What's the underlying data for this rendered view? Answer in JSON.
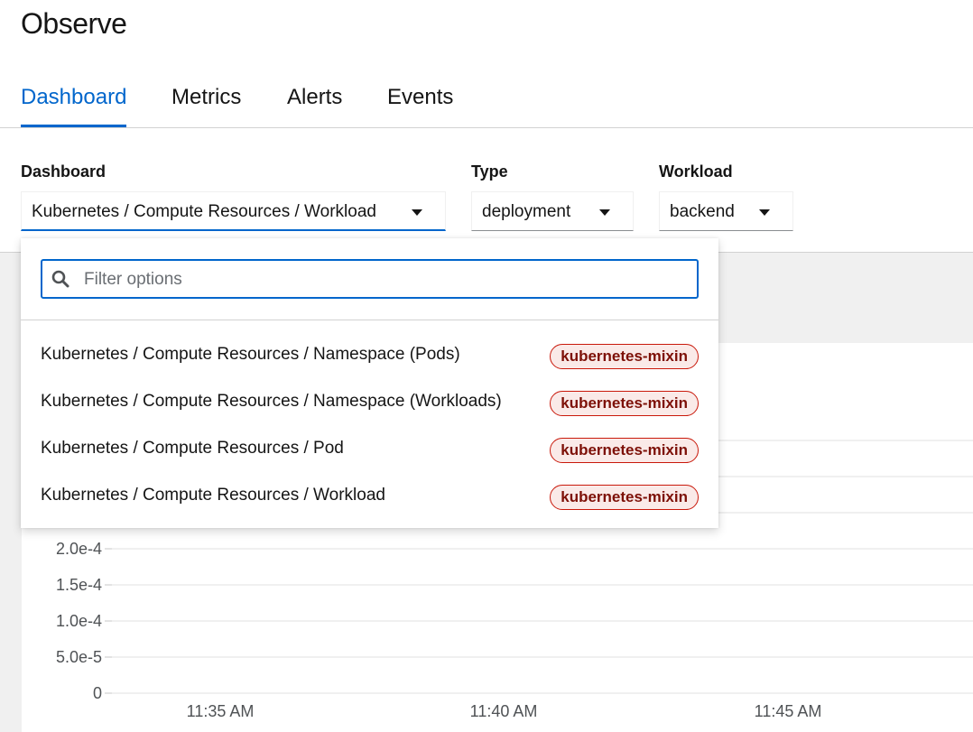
{
  "page": {
    "title": "Observe"
  },
  "tabs": [
    {
      "label": "Dashboard",
      "active": true
    },
    {
      "label": "Metrics",
      "active": false
    },
    {
      "label": "Alerts",
      "active": false
    },
    {
      "label": "Events",
      "active": false
    }
  ],
  "filters": {
    "dashboard": {
      "label": "Dashboard",
      "value": "Kubernetes / Compute Resources / Workload"
    },
    "type": {
      "label": "Type",
      "value": "deployment"
    },
    "workload": {
      "label": "Workload",
      "value": "backend"
    }
  },
  "dropdown": {
    "filter_placeholder": "Filter options",
    "options": [
      {
        "label": "Kubernetes / Compute Resources / Namespace (Pods)",
        "tag": "kubernetes-mixin"
      },
      {
        "label": "Kubernetes / Compute Resources / Namespace (Workloads)",
        "tag": "kubernetes-mixin"
      },
      {
        "label": "Kubernetes / Compute Resources / Pod",
        "tag": "kubernetes-mixin"
      },
      {
        "label": "Kubernetes / Compute Resources / Workload",
        "tag": "kubernetes-mixin"
      }
    ]
  },
  "colors": {
    "accent": "#0066cc",
    "tag_border": "#c9190b",
    "tag_bg": "#faeae8",
    "tag_text": "#7d1007"
  },
  "chart_data": {
    "type": "line",
    "y_ticks": [
      "0",
      "5.0e-5",
      "1.0e-4",
      "1.5e-4",
      "2.0e-4"
    ],
    "x_ticks": [
      "11:35 AM",
      "11:40 AM",
      "11:45 AM"
    ],
    "grid": true,
    "series": []
  }
}
